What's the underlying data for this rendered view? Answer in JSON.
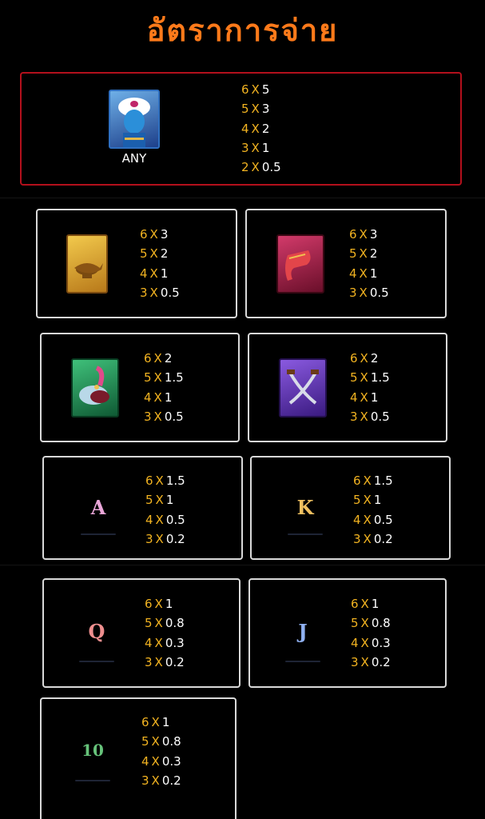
{
  "title": "อัตราการจ่าย",
  "wild": {
    "label": "ANY",
    "icon": "genie-icon",
    "pays": [
      {
        "count": "6",
        "x": "X",
        "value": "5"
      },
      {
        "count": "5",
        "x": "X",
        "value": "3"
      },
      {
        "count": "4",
        "x": "X",
        "value": "2"
      },
      {
        "count": "3",
        "x": "X",
        "value": "1"
      },
      {
        "count": "2",
        "x": "X",
        "value": "0.5"
      }
    ]
  },
  "symbols": [
    {
      "icon": "magic-lamp-icon",
      "pays": [
        {
          "count": "6",
          "x": "X",
          "value": "3"
        },
        {
          "count": "5",
          "x": "X",
          "value": "2"
        },
        {
          "count": "4",
          "x": "X",
          "value": "1"
        },
        {
          "count": "3",
          "x": "X",
          "value": "0.5"
        }
      ]
    },
    {
      "icon": "flying-carpet-icon",
      "pays": [
        {
          "count": "6",
          "x": "X",
          "value": "3"
        },
        {
          "count": "5",
          "x": "X",
          "value": "2"
        },
        {
          "count": "4",
          "x": "X",
          "value": "1"
        },
        {
          "count": "3",
          "x": "X",
          "value": "0.5"
        }
      ]
    },
    {
      "icon": "feathered-turban-icon",
      "pays": [
        {
          "count": "6",
          "x": "X",
          "value": "2"
        },
        {
          "count": "5",
          "x": "X",
          "value": "1.5"
        },
        {
          "count": "4",
          "x": "X",
          "value": "1"
        },
        {
          "count": "3",
          "x": "X",
          "value": "0.5"
        }
      ]
    },
    {
      "icon": "crossed-daggers-icon",
      "pays": [
        {
          "count": "6",
          "x": "X",
          "value": "2"
        },
        {
          "count": "5",
          "x": "X",
          "value": "1.5"
        },
        {
          "count": "4",
          "x": "X",
          "value": "1"
        },
        {
          "count": "3",
          "x": "X",
          "value": "0.5"
        }
      ]
    },
    {
      "icon": "letter-a-icon",
      "letter": "A",
      "color": "#e9a6d8",
      "pays": [
        {
          "count": "6",
          "x": "X",
          "value": "1.5"
        },
        {
          "count": "5",
          "x": "X",
          "value": "1"
        },
        {
          "count": "4",
          "x": "X",
          "value": "0.5"
        },
        {
          "count": "3",
          "x": "X",
          "value": "0.2"
        }
      ]
    },
    {
      "icon": "letter-k-icon",
      "letter": "K",
      "color": "#f0c060",
      "pays": [
        {
          "count": "6",
          "x": "X",
          "value": "1.5"
        },
        {
          "count": "5",
          "x": "X",
          "value": "1"
        },
        {
          "count": "4",
          "x": "X",
          "value": "0.5"
        },
        {
          "count": "3",
          "x": "X",
          "value": "0.2"
        }
      ]
    },
    {
      "icon": "letter-q-icon",
      "letter": "Q",
      "color": "#ee8f8f",
      "pays": [
        {
          "count": "6",
          "x": "X",
          "value": "1"
        },
        {
          "count": "5",
          "x": "X",
          "value": "0.8"
        },
        {
          "count": "4",
          "x": "X",
          "value": "0.3"
        },
        {
          "count": "3",
          "x": "X",
          "value": "0.2"
        }
      ]
    },
    {
      "icon": "letter-j-icon",
      "letter": "J",
      "color": "#8fb0f0",
      "pays": [
        {
          "count": "6",
          "x": "X",
          "value": "1"
        },
        {
          "count": "5",
          "x": "X",
          "value": "0.8"
        },
        {
          "count": "4",
          "x": "X",
          "value": "0.3"
        },
        {
          "count": "3",
          "x": "X",
          "value": "0.2"
        }
      ]
    },
    {
      "icon": "number-10-icon",
      "letter": "10",
      "color": "#66c27a",
      "pays": [
        {
          "count": "6",
          "x": "X",
          "value": "1"
        },
        {
          "count": "5",
          "x": "X",
          "value": "0.8"
        },
        {
          "count": "4",
          "x": "X",
          "value": "0.3"
        },
        {
          "count": "3",
          "x": "X",
          "value": "0.2"
        }
      ]
    }
  ]
}
